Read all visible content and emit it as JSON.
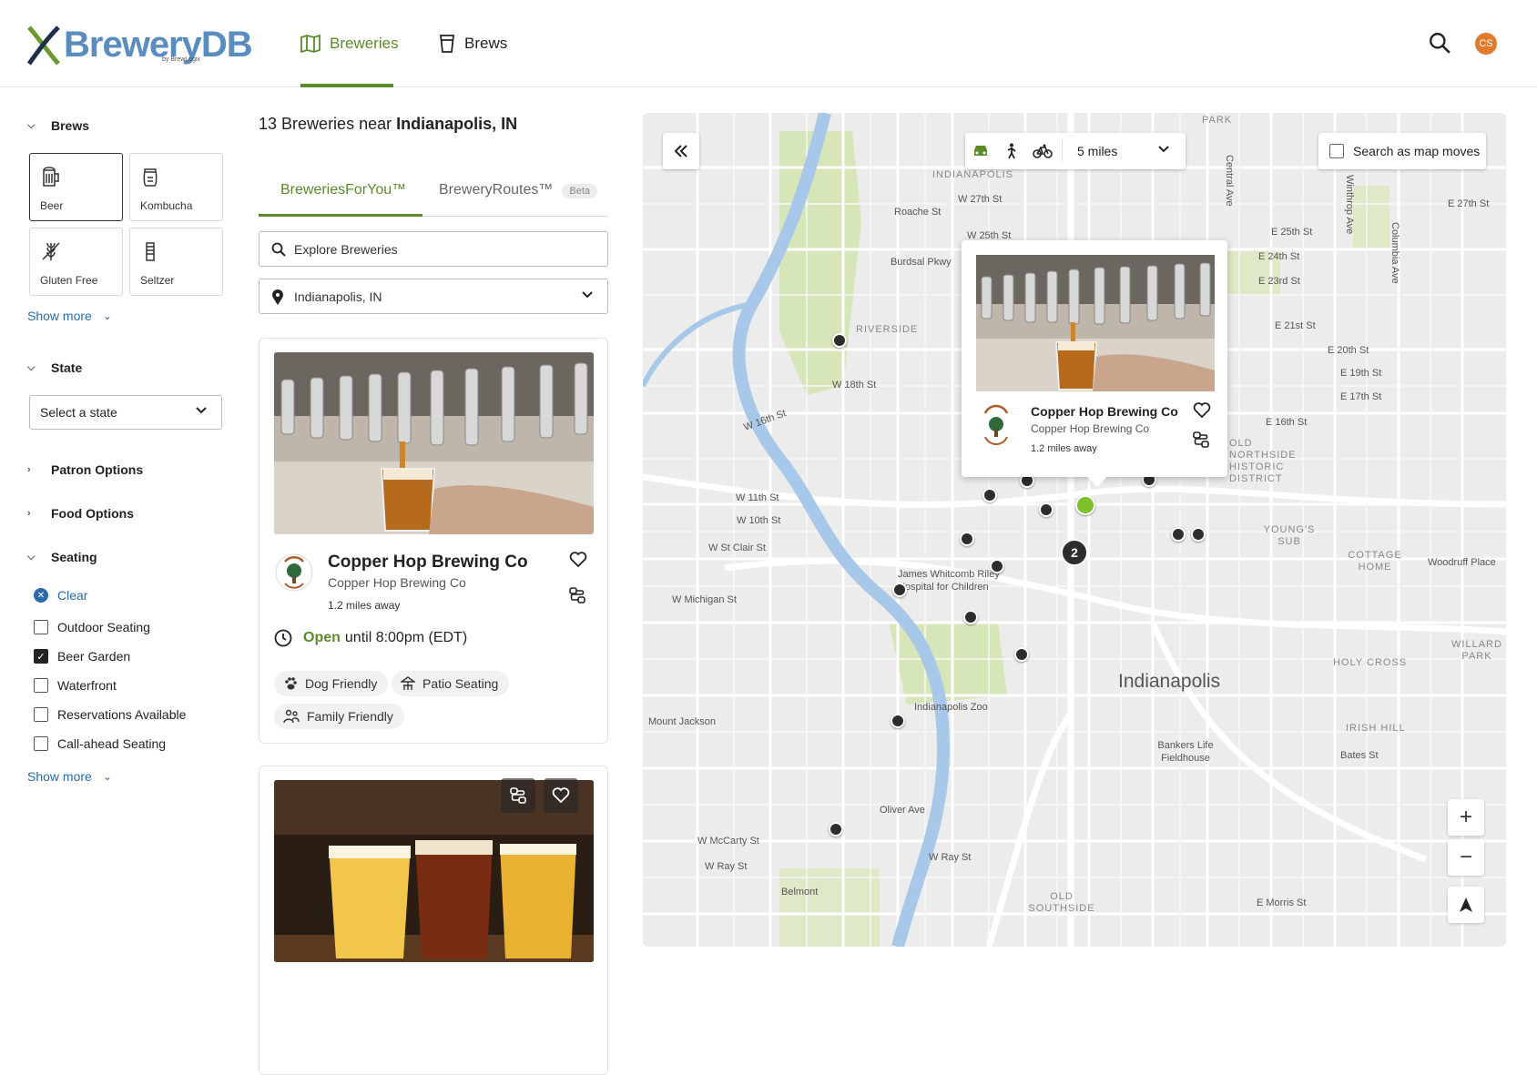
{
  "header": {
    "logo_text": "BreweryDB",
    "logo_sub": "by BrewLogix",
    "nav": [
      {
        "label": "Breweries"
      },
      {
        "label": "Brews"
      }
    ],
    "avatar_initials": "CS",
    "accent_color": "#5a8a2a",
    "avatar_color": "#e07a2c"
  },
  "sidebar": {
    "brews_title": "Brews",
    "brew_types": [
      {
        "label": "Beer",
        "icon": "beer-icon"
      },
      {
        "label": "Kombucha",
        "icon": "kombucha-icon"
      },
      {
        "label": "Gluten Free",
        "icon": "gluten-free-icon"
      },
      {
        "label": "Seltzer",
        "icon": "seltzer-icon"
      }
    ],
    "show_more": "Show more",
    "state_title": "State",
    "state_placeholder": "Select a state",
    "patron_title": "Patron Options",
    "food_title": "Food Options",
    "seating_title": "Seating",
    "clear": "Clear",
    "seating_options": [
      {
        "label": "Outdoor Seating",
        "checked": false
      },
      {
        "label": "Beer Garden",
        "checked": true
      },
      {
        "label": "Waterfront",
        "checked": false
      },
      {
        "label": "Reservations Available",
        "checked": false
      },
      {
        "label": "Call-ahead Seating",
        "checked": false
      }
    ],
    "show_more_2": "Show more"
  },
  "list": {
    "count": "13",
    "near_text": "Breweries near",
    "location": "Indianapolis, IN",
    "tabs": [
      {
        "label": "BreweriesForYou™"
      },
      {
        "label": "BreweryRoutes™",
        "badge": "Beta"
      }
    ],
    "search_placeholder": "Explore Breweries",
    "location_value": "Indianapolis, IN",
    "card": {
      "name": "Copper Hop Brewing Co",
      "subtitle": "Copper Hop Brewing Co",
      "distance": "1.2 miles away",
      "open_label": "Open",
      "hours": "until 8:00pm (EDT)",
      "tags": [
        "Dog Friendly",
        "Patio Seating",
        "Family Friendly"
      ]
    }
  },
  "map": {
    "travel_distance": "5 miles",
    "search_as_moves": "Search as map moves",
    "popup": {
      "name": "Copper Hop Brewing Co",
      "subtitle": "Copper Hop Brewing Co",
      "distance": "1.2 miles away"
    },
    "cluster_count": "2",
    "city_label": "Indianapolis",
    "labels": {
      "indianapolis_nc": "INDIANAPOLIS",
      "w27": "W 27th St",
      "roache": "Roache St",
      "w25": "W 25th St",
      "burdsal": "Burdsal Pkwy",
      "riverside": "RIVERSIDE",
      "w18": "W 18th St",
      "w16": "W 16th St",
      "w11": "W 11th St",
      "w10": "W 10th St",
      "wstclair": "W St Clair St",
      "wmichigan": "W Michigan St",
      "riley": "James Whitcomb Riley Hospital for Children",
      "zoo": "Indianapolis Zoo",
      "mtjackson": "Mount Jackson",
      "bankers": "Bankers Life Fieldhouse",
      "oliver": "Oliver Ave",
      "wmccarty": "W McCarty St",
      "wray": "W Ray St",
      "wray2": "W Ray St",
      "belmont": "Belmont",
      "oldsouthside": "OLD SOUTHSIDE",
      "emorris": "E Morris St",
      "bates": "Bates St",
      "irishhill": "IRISH HILL",
      "holycross": "HOLY CROSS",
      "willard": "WILLARD PARK",
      "cottage": "COTTAGE HOME",
      "woodruff": "Woodruff Place",
      "young": "YOUNG'S SUB",
      "ninorth": "OLD NORTHSIDE HISTORIC DISTRICT",
      "e16": "E 16th St",
      "e17": "E 17th St",
      "e19": "E 19th St",
      "e20": "E 20th St",
      "e21": "E 21st St",
      "e23": "E 23rd St",
      "e24": "E 24th St",
      "e25": "E 25th St",
      "e27": "E 27th St",
      "park": "PARK",
      "central": "Central Ave",
      "winthrop": "Winthrop Ave",
      "columbia": "Columbia Ave"
    }
  }
}
